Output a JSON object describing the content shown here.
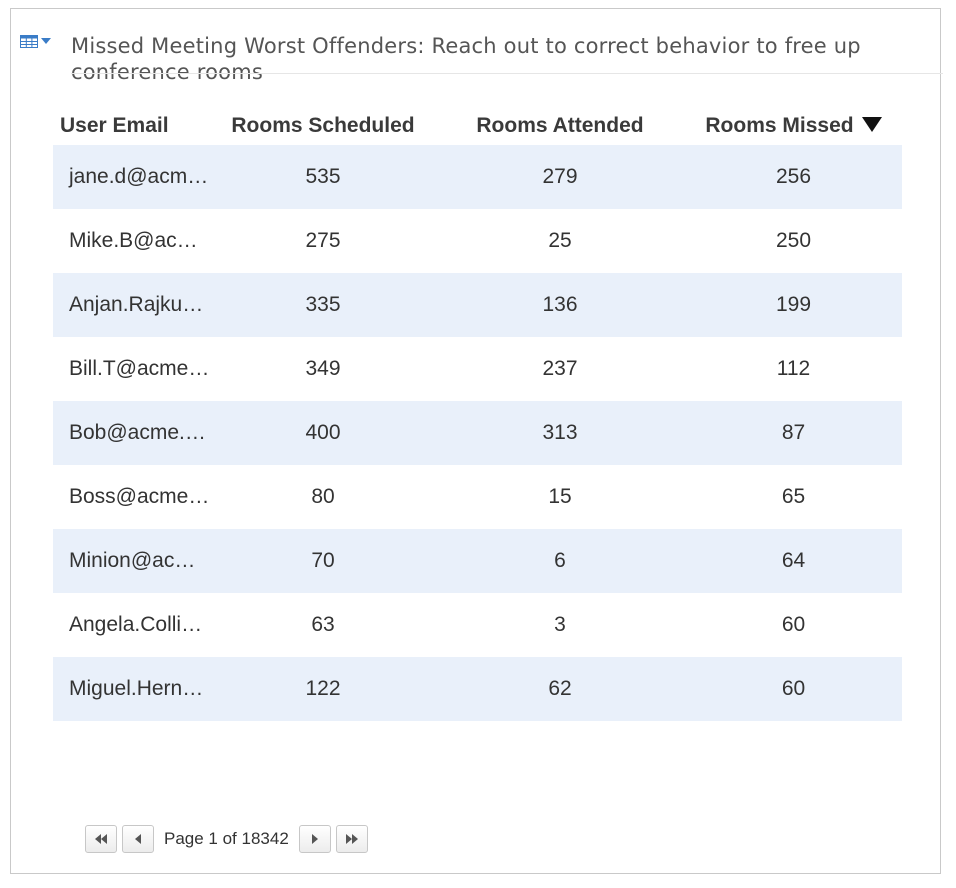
{
  "widget": {
    "title": "Missed Meeting Worst Offenders: Reach out to correct behavior to free up conference rooms",
    "menu_icon": "table-icon",
    "accent_color": "#3a7cc7"
  },
  "table": {
    "headers": [
      "User Email",
      "Rooms Scheduled",
      "Rooms Attended",
      "Rooms Missed"
    ],
    "sorted_column": "Rooms Missed",
    "sort_direction": "descending",
    "row_alt_color": "#e9f0fa",
    "rows": [
      {
        "email": "jane.d@acm…",
        "scheduled": "535",
        "attended": "279",
        "missed": "256"
      },
      {
        "email": "Mike.B@ac…",
        "scheduled": "275",
        "attended": "25",
        "missed": "250"
      },
      {
        "email": "Anjan.Rajku…",
        "scheduled": "335",
        "attended": "136",
        "missed": "199"
      },
      {
        "email": "Bill.T@acme…",
        "scheduled": "349",
        "attended": "237",
        "missed": "112"
      },
      {
        "email": "Bob@acme.…",
        "scheduled": "400",
        "attended": "313",
        "missed": "87"
      },
      {
        "email": "Boss@acme…",
        "scheduled": "80",
        "attended": "15",
        "missed": "65"
      },
      {
        "email": "Minion@ac…",
        "scheduled": "70",
        "attended": "6",
        "missed": "64"
      },
      {
        "email": "Angela.Colli…",
        "scheduled": "63",
        "attended": "3",
        "missed": "60"
      },
      {
        "email": "Miguel.Hern…",
        "scheduled": "122",
        "attended": "62",
        "missed": "60"
      }
    ]
  },
  "pager": {
    "label": "Page 1 of 18342",
    "first_icon": "first-page-icon",
    "prev_icon": "previous-page-icon",
    "next_icon": "next-page-icon",
    "last_icon": "last-page-icon"
  }
}
